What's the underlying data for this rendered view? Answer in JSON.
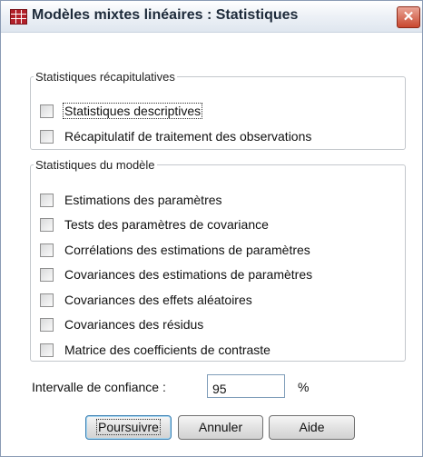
{
  "window": {
    "title": "Modèles mixtes linéaires : Statistiques",
    "close_glyph": "✕"
  },
  "summary_group": {
    "legend": "Statistiques récapitulatives",
    "options": [
      {
        "label": "Statistiques descriptives",
        "checked": false
      },
      {
        "label": "Récapitulatif de traitement des observations",
        "checked": false
      }
    ]
  },
  "model_group": {
    "legend": "Statistiques du modèle",
    "options": [
      {
        "label": "Estimations des paramètres",
        "checked": false
      },
      {
        "label": "Tests des paramètres de covariance",
        "checked": false
      },
      {
        "label": "Corrélations des estimations de paramètres",
        "checked": false
      },
      {
        "label": "Covariances des estimations de paramètres",
        "checked": false
      },
      {
        "label": "Covariances des effets aléatoires",
        "checked": false
      },
      {
        "label": "Covariances des résidus",
        "checked": false
      },
      {
        "label": "Matrice des coefficients de contraste",
        "checked": false
      }
    ]
  },
  "confidence": {
    "label": "Intervalle de confiance :",
    "value": "95",
    "unit": "%"
  },
  "buttons": {
    "continue": "Poursuivre",
    "cancel": "Annuler",
    "help": "Aide"
  }
}
